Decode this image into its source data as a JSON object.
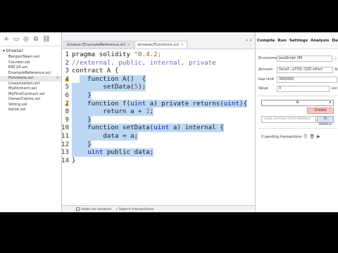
{
  "sidebar": {
    "section_title": "browser",
    "files": [
      {
        "name": "BergenToken.sol",
        "active": false
      },
      {
        "name": "Counter.sol",
        "active": false
      },
      {
        "name": "ERC20.sol",
        "active": false
      },
      {
        "name": "ExampleReference.sol",
        "active": false
      },
      {
        "name": "Functions.sol",
        "active": true
      },
      {
        "name": "Linearization.sol",
        "active": false
      },
      {
        "name": "Multiinherit.sol",
        "active": false
      },
      {
        "name": "MyFirstContract.sol",
        "active": false
      },
      {
        "name": "OwnerClaims.sol",
        "active": false
      },
      {
        "name": "Voting.sol",
        "active": false
      },
      {
        "name": "ballot.sol",
        "active": false
      }
    ]
  },
  "editor": {
    "tabs": [
      {
        "label": "browser/ExampleReference.sol",
        "active": false
      },
      {
        "label": "browser/Functions.sol",
        "active": true
      }
    ],
    "lines": [
      {
        "n": "1",
        "warn": false,
        "sel": null,
        "parts": [
          {
            "t": "pragma solidity ",
            "c": ""
          },
          {
            "t": "^0.4.2;",
            "c": "num"
          }
        ]
      },
      {
        "n": "2",
        "warn": false,
        "sel": null,
        "parts": [
          {
            "t": "//external, public, internal, private",
            "c": "cm"
          }
        ]
      },
      {
        "n": "3",
        "warn": false,
        "sel": null,
        "parts": [
          {
            "t": "contract A {",
            "c": ""
          }
        ]
      },
      {
        "n": "4",
        "warn": true,
        "sel": [
          2,
          999
        ],
        "parts": [
          {
            "t": "    function A()  {",
            "c": ""
          }
        ]
      },
      {
        "n": "5",
        "warn": false,
        "sel": [
          0,
          999
        ],
        "parts": [
          {
            "t": "        setData(",
            "c": ""
          },
          {
            "t": "5",
            "c": "num"
          },
          {
            "t": ");",
            "c": ""
          }
        ]
      },
      {
        "n": "6",
        "warn": false,
        "sel": [
          0,
          999
        ],
        "parts": [
          {
            "t": "    }",
            "c": ""
          }
        ]
      },
      {
        "n": "7",
        "warn": true,
        "sel": [
          0,
          999
        ],
        "parts": [
          {
            "t": "    function f(",
            "c": ""
          },
          {
            "t": "uint",
            "c": "kw"
          },
          {
            "t": " a) private returns(",
            "c": ""
          },
          {
            "t": "uint",
            "c": "kw"
          },
          {
            "t": "){",
            "c": ""
          }
        ]
      },
      {
        "n": "8",
        "warn": false,
        "sel": [
          0,
          999
        ],
        "parts": [
          {
            "t": "        return a + ",
            "c": ""
          },
          {
            "t": "1",
            "c": "num"
          },
          {
            "t": ";",
            "c": ""
          }
        ]
      },
      {
        "n": "9",
        "warn": false,
        "sel": [
          0,
          999
        ],
        "parts": [
          {
            "t": "    }",
            "c": ""
          }
        ]
      },
      {
        "n": "10",
        "warn": false,
        "sel": [
          0,
          999
        ],
        "parts": [
          {
            "t": "    function setData(",
            "c": ""
          },
          {
            "t": "uint",
            "c": "kw"
          },
          {
            "t": " a) internal {",
            "c": ""
          }
        ]
      },
      {
        "n": "11",
        "warn": false,
        "sel": [
          0,
          999
        ],
        "parts": [
          {
            "t": "        data = a;",
            "c": ""
          }
        ]
      },
      {
        "n": "12",
        "warn": false,
        "sel": [
          0,
          999
        ],
        "parts": [
          {
            "t": "    }",
            "c": ""
          }
        ]
      },
      {
        "n": "13",
        "warn": false,
        "sel": [
          0,
          999
        ],
        "parts": [
          {
            "t": "    ",
            "c": ""
          },
          {
            "t": "uint",
            "c": "kw"
          },
          {
            "t": " public data;",
            "c": ""
          }
        ]
      },
      {
        "n": "14",
        "warn": false,
        "sel": null,
        "parts": [
          {
            "t": "}",
            "c": ""
          }
        ]
      }
    ],
    "bottom_label": "listen on network",
    "bottom_search": "Search transactions"
  },
  "right": {
    "tabs": [
      "Compile",
      "Run",
      "Settings",
      "Analysis",
      "Debugger",
      "S"
    ],
    "environment_label": "Environment",
    "environment_value": "JavaScript VM",
    "account_label": "Account",
    "account_value": "0xca3...a733c (100 ether)",
    "gas_label": "Gas limit",
    "gas_value": "3000000",
    "value_label": "Value",
    "value_value": "0",
    "value_unit": "wei",
    "contract_select": "A",
    "create_label": "Create",
    "load_placeholder": "Load contract from Address",
    "at_address_label": "At Address",
    "pending_label": "0 pending transactions"
  },
  "colors": {
    "selection": "#bcd8f4",
    "keyword": "#1a1aa6",
    "comment": "#6b6bb3",
    "number": "#b5522a",
    "create_button": "#f4c7c0"
  }
}
